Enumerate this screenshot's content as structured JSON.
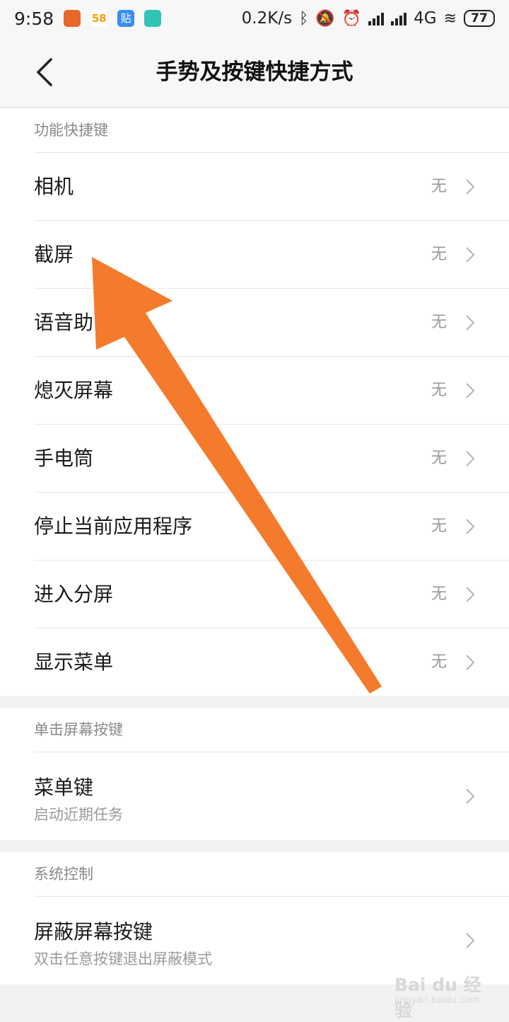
{
  "status_bar": {
    "time": "9:58",
    "app_icons": [
      {
        "name": "weibo-app-icon",
        "color": "#e8672a",
        "label": ""
      },
      {
        "name": "58-app-icon",
        "color": "#ffffff",
        "label": "58"
      },
      {
        "name": "tieba-app-icon",
        "color": "#3a8ef2",
        "label": "贴"
      },
      {
        "name": "boss-app-icon",
        "color": "#2ec4b6",
        "label": ""
      }
    ],
    "net_speed": "0.2K/s",
    "network": "4G",
    "battery": "77"
  },
  "header": {
    "title": "手势及按键快捷方式"
  },
  "sections": {
    "function_shortcuts": {
      "title": "功能快捷键",
      "items": [
        {
          "label": "相机",
          "value": "无"
        },
        {
          "label": "截屏",
          "value": "无"
        },
        {
          "label": "语音助",
          "value": "无"
        },
        {
          "label": "熄灭屏幕",
          "value": "无"
        },
        {
          "label": "手电筒",
          "value": "无"
        },
        {
          "label": "停止当前应用程序",
          "value": "无"
        },
        {
          "label": "进入分屏",
          "value": "无"
        },
        {
          "label": "显示菜单",
          "value": "无"
        }
      ]
    },
    "tap_screen_keys": {
      "title": "单击屏幕按键",
      "item": {
        "label": "菜单键",
        "sub": "启动近期任务"
      }
    },
    "system_control": {
      "title": "系统控制",
      "item": {
        "label": "屏蔽屏幕按键",
        "sub": "双击任意按键退出屏蔽模式"
      }
    }
  },
  "annotation": {
    "arrow_color": "#f47a2c"
  },
  "watermark": {
    "text": "Bai du 经验",
    "sub": "jingyan.baidu.com"
  }
}
